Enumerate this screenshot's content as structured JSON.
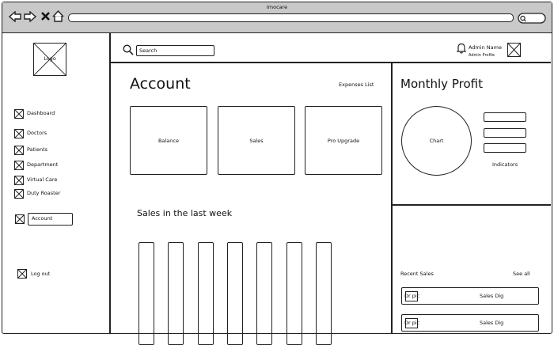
{
  "browser": {
    "title": "Imocare"
  },
  "sidebar": {
    "logo": "Logo",
    "items": [
      {
        "label": "Dashboard"
      },
      {
        "label": "Doctors"
      },
      {
        "label": "Patients"
      },
      {
        "label": "Department"
      },
      {
        "label": "Virtual Care"
      },
      {
        "label": "Duty Roaster"
      }
    ],
    "account": "Account",
    "logout": "Log out"
  },
  "topbar": {
    "search_value": "Search",
    "admin_name": "Admin Name",
    "admin_profile": "Admin Profile"
  },
  "main": {
    "title": "Account",
    "expenses_link": "Expenses List",
    "cards": [
      {
        "label": "Balance"
      },
      {
        "label": "Sales"
      },
      {
        "label": "Pro Upgrade"
      }
    ],
    "sales_title": "Sales in the last week",
    "bar_count": 7
  },
  "profit": {
    "title": "Monthly Profit",
    "chart_label": "Chart",
    "indicators_label": "Indicators"
  },
  "recent": {
    "title": "Recent Sales",
    "see_all": "See all",
    "rows": [
      {
        "pic": "Dr pic",
        "label": "Sales Dig"
      },
      {
        "pic": "Dr pic",
        "label": "Sales Dig"
      }
    ]
  }
}
